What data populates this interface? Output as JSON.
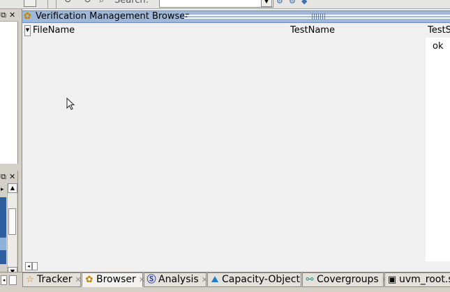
{
  "toolbar": {
    "search_label": "Search:",
    "search_value": "",
    "search_placeholder": ""
  },
  "left_panel_top": {
    "restore_icon": "restore-icon",
    "close_icon": "close-icon"
  },
  "browser": {
    "title": "Verification Management Browser",
    "columns": [
      "FileName",
      "TestName",
      "TestS"
    ],
    "rows": [
      {
        "filename": "",
        "testname": "",
        "status": "ok"
      }
    ]
  },
  "tabs": [
    {
      "label": "Tracker",
      "icon": "star-icon",
      "active": false
    },
    {
      "label": "Browser",
      "icon": "browser-icon",
      "active": true
    },
    {
      "label": "Analysis",
      "icon": "analysis-icon",
      "active": false
    },
    {
      "label": "Capacity-Object",
      "icon": "capacity-chart-icon",
      "active": false
    },
    {
      "label": "Covergroups",
      "icon": "covergroups-icon",
      "active": false
    },
    {
      "label": "uvm_root.sv",
      "icon": "source-file-icon",
      "active": false
    }
  ],
  "colors": {
    "titlebar": "#9fb8d8",
    "status_column": "#ffffff",
    "tree_selection": "#2d5d9f"
  }
}
